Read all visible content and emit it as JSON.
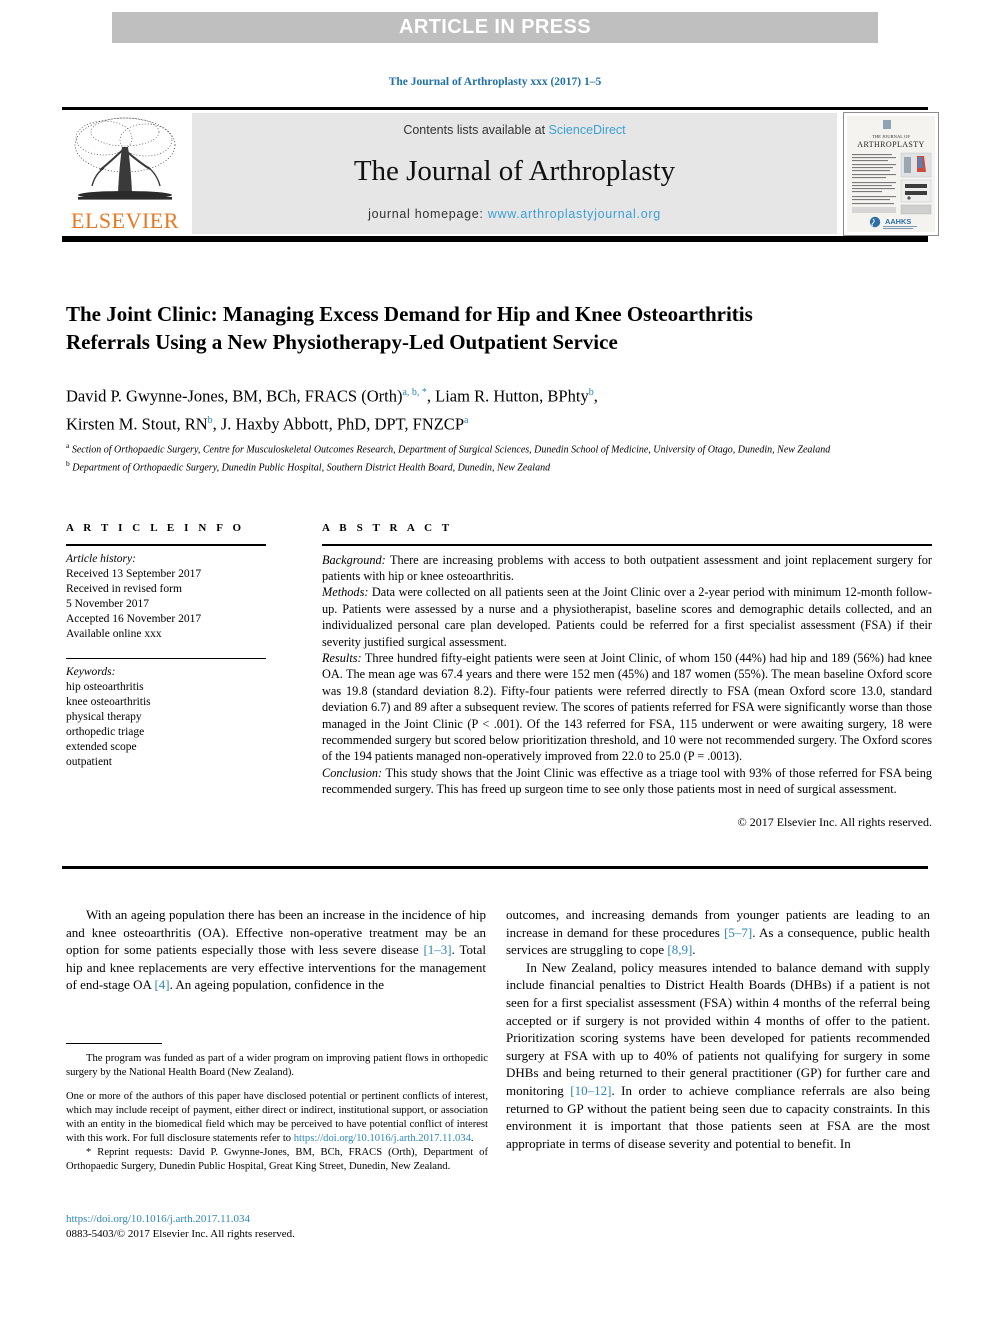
{
  "banner": {
    "text": "ARTICLE IN PRESS"
  },
  "journal_ref": "The Journal of Arthroplasty xxx (2017) 1–5",
  "masthead": {
    "contents_prefix": "Contents lists available at ",
    "contents_link": "ScienceDirect",
    "journal_name": "The Journal of Arthroplasty",
    "homepage_prefix": "journal homepage: ",
    "homepage_link": "www.arthroplastyjournal.org",
    "publisher_logo_text": "ELSEVIER",
    "cover": {
      "line1": "THE JOURNAL OF",
      "line2": "ARTHROPLASTY",
      "society": "AAHKS"
    }
  },
  "article": {
    "title": "The Joint Clinic: Managing Excess Demand for Hip and Knee Osteoarthritis Referrals Using a New Physiotherapy-Led Outpatient Service",
    "authors_line1_a": "David P. Gwynne-Jones, BM, BCh, FRACS (Orth)",
    "authors_line1_sup": "a, b, *",
    "authors_line1_b": ", Liam R. Hutton, BPhty",
    "authors_line1_sup2": "b",
    "authors_line1_c": ",",
    "authors_line2_a": "Kirsten M. Stout, RN",
    "authors_line2_sup": "b",
    "authors_line2_b": ", J. Haxby Abbott, PhD, DPT, FNZCP",
    "authors_line2_sup2": "a",
    "affiliation_a_mark": "a",
    "affiliation_a": "Section of Orthopaedic Surgery, Centre for Musculoskeletal Outcomes Research, Department of Surgical Sciences, Dunedin School of Medicine, University of Otago, Dunedin, New Zealand",
    "affiliation_b_mark": "b",
    "affiliation_b": "Department of Orthopaedic Surgery, Dunedin Public Hospital, Southern District Health Board, Dunedin, New Zealand"
  },
  "article_info": {
    "heading": "A R T I C L E   I N F O",
    "history_label": "Article history:",
    "history": [
      "Received 13 September 2017",
      "Received in revised form",
      "5 November 2017",
      "Accepted 16 November 2017",
      "Available online xxx"
    ],
    "keywords_label": "Keywords:",
    "keywords": [
      "hip osteoarthritis",
      "knee osteoarthritis",
      "physical therapy",
      "orthopedic triage",
      "extended scope",
      "outpatient"
    ]
  },
  "abstract": {
    "heading": "A B S T R A C T",
    "background_label": "Background:",
    "background_text": " There are increasing problems with access to both outpatient assessment and joint replacement surgery for patients with hip or knee osteoarthritis.",
    "methods_label": "Methods:",
    "methods_text": " Data were collected on all patients seen at the Joint Clinic over a 2-year period with minimum 12-month follow-up. Patients were assessed by a nurse and a physiotherapist, baseline scores and demographic details collected, and an individualized personal care plan developed. Patients could be referred for a first specialist assessment (FSA) if their severity justified surgical assessment.",
    "results_label": "Results:",
    "results_text": " Three hundred fifty-eight patients were seen at Joint Clinic, of whom 150 (44%) had hip and 189 (56%) had knee OA. The mean age was 67.4 years and there were 152 men (45%) and 187 women (55%). The mean baseline Oxford score was 19.8 (standard deviation 8.2). Fifty-four patients were referred directly to FSA (mean Oxford score 13.0, standard deviation 6.7) and 89 after a subsequent review. The scores of patients referred for FSA were significantly worse than those managed in the Joint Clinic (P < .001). Of the 143 referred for FSA, 115 underwent or were awaiting surgery, 18 were recommended surgery but scored below prioritization threshold, and 10 were not recommended surgery. The Oxford scores of the 194 patients managed non-operatively improved from 22.0 to 25.0 (P = .0013).",
    "conclusion_label": "Conclusion:",
    "conclusion_text": " This study shows that the Joint Clinic was effective as a triage tool with 93% of those referred for FSA being recommended surgery. This has freed up surgeon time to see only those patients most in need of surgical assessment.",
    "copyright": "© 2017 Elsevier Inc. All rights reserved."
  },
  "body": {
    "left_p1_a": "With an ageing population there has been an increase in the incidence of hip and knee osteoarthritis (OA). Effective non-operative treatment may be an option for some patients especially those with less severe disease ",
    "left_p1_ref1": "[1–3]",
    "left_p1_b": ". Total hip and knee replacements are very effective interventions for the management of end-stage OA ",
    "left_p1_ref2": "[4]",
    "left_p1_c": ". An ageing population, confidence in the",
    "right_p1_a": "outcomes, and increasing demands from younger patients are leading to an increase in demand for these procedures ",
    "right_p1_ref1": "[5–7]",
    "right_p1_b": ". As a consequence, public health services are struggling to cope ",
    "right_p1_ref2": "[8,9]",
    "right_p1_c": ".",
    "right_p2_a": "In New Zealand, policy measures intended to balance demand with supply include financial penalties to District Health Boards (DHBs) if a patient is not seen for a first specialist assessment (FSA) within 4 months of the referral being accepted or if surgery is not provided within 4 months of offer to the patient. Prioritization scoring systems have been developed for patients recommended surgery at FSA with up to 40% of patients not qualifying for surgery in some DHBs and being returned to their general practitioner (GP) for further care and monitoring ",
    "right_p2_ref1": "[10–12]",
    "right_p2_b": ". In order to achieve compliance referrals are also being returned to GP without the patient being seen due to capacity constraints. In this environment it is important that those patients seen at FSA are the most appropriate in terms of disease severity and potential to benefit. In"
  },
  "footnotes": {
    "funding": "The program was funded as part of a wider program on improving patient flows in orthopedic surgery by the National Health Board (New Zealand).",
    "conflicts_a": "One or more of the authors of this paper have disclosed potential or pertinent conflicts of interest, which may include receipt of payment, either direct or indirect, institutional support, or association with an entity in the biomedical field which may be perceived to have potential conflict of interest with this work. For full disclosure statements refer to ",
    "conflicts_link": "https://doi.org/10.1016/j.arth.2017.11.034",
    "conflicts_b": ".",
    "reprint_mark": "*",
    "reprint": " Reprint requests: David P. Gwynne-Jones, BM, BCh, FRACS (Orth), Department of Orthopaedic Surgery, Dunedin Public Hospital, Great King Street, Dunedin, New Zealand.",
    "doi_link": "https://doi.org/10.1016/j.arth.2017.11.034",
    "issn_line": "0883-5403/© 2017 Elsevier Inc. All rights reserved."
  },
  "colors": {
    "banner_bg": "#bfbfbf",
    "link_blue": "#2e86b8",
    "sciencedirect_blue": "#3ca0d8",
    "elsevier_orange": "#e87722",
    "masthead_bg": "#e6e6e6"
  }
}
